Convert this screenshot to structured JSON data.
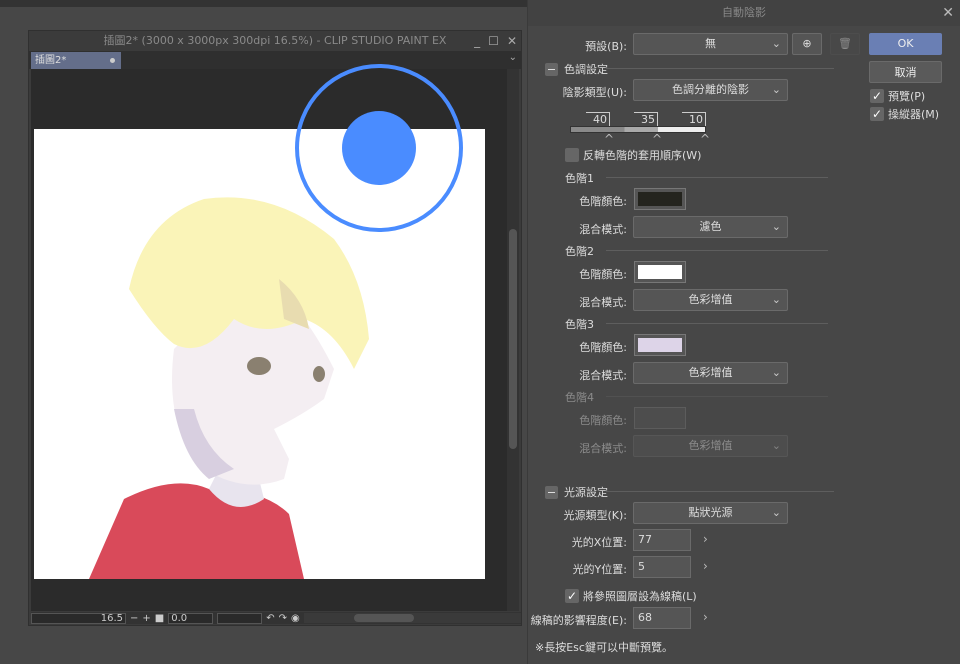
{
  "window": {
    "title": "插圖2* (3000 x 3000px 300dpi 16.5%) - CLIP STUDIO PAINT EX",
    "tab": "插圖2*",
    "minimize": "_",
    "maximize": "☐",
    "close": "✕",
    "tab_menu": "⌄"
  },
  "bottom": {
    "zoom": "16.5",
    "minus": "−",
    "plus": "+",
    "angle": "0.0"
  },
  "dialog": {
    "title": "自動陰影",
    "close": "✕",
    "preset_label": "預設(B):",
    "preset_value": "無",
    "ok": "OK",
    "cancel": "取消",
    "preview": "預覽(P)",
    "manipulator": "操縱器(M)",
    "tone_section": "色調設定",
    "shadow_type_label": "陰影類型(U):",
    "shadow_type_value": "色調分離的陰影",
    "thresholds": [
      "40",
      "35",
      "10"
    ],
    "reverse_label": "反轉色階的套用順序(W)",
    "levels": [
      {
        "title": "色階1",
        "color_label": "色階顏色:",
        "color": "#24241e",
        "blend_label": "混合模式:",
        "blend": "濾色"
      },
      {
        "title": "色階2",
        "color_label": "色階顏色:",
        "color": "#ffffff",
        "blend_label": "混合模式:",
        "blend": "色彩增值"
      },
      {
        "title": "色階3",
        "color_label": "色階顏色:",
        "color": "#ddd4e8",
        "blend_label": "混合模式:",
        "blend": "色彩增值"
      },
      {
        "title": "色階4",
        "color_label": "色階顏色:",
        "color": "#555555",
        "blend_label": "混合模式:",
        "blend": "色彩增值"
      }
    ],
    "light_section": "光源設定",
    "light_type_label": "光源類型(K):",
    "light_type_value": "點狀光源",
    "light_x_label": "光的X位置:",
    "light_x": "77",
    "light_y_label": "光的Y位置:",
    "light_y": "5",
    "lineart_label": "將參照圖層設為線稿(L)",
    "influence_label": "線稿的影響程度(E):",
    "influence": "68",
    "hint": "※長按Esc鍵可以中斷預覽。"
  },
  "colors": {
    "accent": "#4a8cff",
    "ok": "#6a7fb4"
  }
}
